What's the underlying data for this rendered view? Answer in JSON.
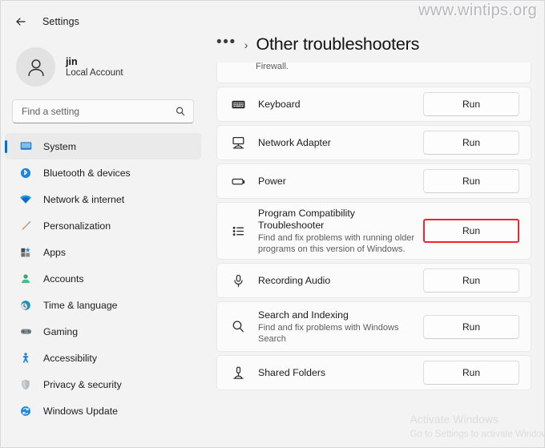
{
  "window": {
    "app_title": "Settings",
    "back_icon": "back-arrow-icon"
  },
  "account": {
    "name": "jin",
    "type": "Local Account",
    "avatar_icon": "user-avatar-icon"
  },
  "search": {
    "placeholder": "Find a setting",
    "value": "",
    "icon": "search-icon"
  },
  "sidebar": {
    "items": [
      {
        "label": "System",
        "icon": "monitor-icon",
        "selected": true
      },
      {
        "label": "Bluetooth & devices",
        "icon": "bluetooth-icon",
        "selected": false
      },
      {
        "label": "Network & internet",
        "icon": "wifi-icon",
        "selected": false
      },
      {
        "label": "Personalization",
        "icon": "paintbrush-icon",
        "selected": false
      },
      {
        "label": "Apps",
        "icon": "apps-icon",
        "selected": false
      },
      {
        "label": "Accounts",
        "icon": "account-person-icon",
        "selected": false
      },
      {
        "label": "Time & language",
        "icon": "clock-globe-icon",
        "selected": false
      },
      {
        "label": "Gaming",
        "icon": "gamepad-icon",
        "selected": false
      },
      {
        "label": "Accessibility",
        "icon": "accessibility-person-icon",
        "selected": false
      },
      {
        "label": "Privacy & security",
        "icon": "shield-icon",
        "selected": false
      },
      {
        "label": "Windows Update",
        "icon": "update-refresh-icon",
        "selected": false
      }
    ]
  },
  "header": {
    "breadcrumb_overflow": "•••",
    "breadcrumb_separator": "›",
    "title": "Other troubleshooters"
  },
  "troubleshooters": [
    {
      "id": "firewall-clipped",
      "title": "",
      "desc": "Firewall.",
      "icon": "",
      "button": "",
      "highlighted": false,
      "clipped": true
    },
    {
      "id": "keyboard",
      "title": "Keyboard",
      "desc": "",
      "icon": "keyboard-icon",
      "button": "Run",
      "highlighted": false,
      "clipped": false
    },
    {
      "id": "network-adapter",
      "title": "Network Adapter",
      "desc": "",
      "icon": "network-adapter-icon",
      "button": "Run",
      "highlighted": false,
      "clipped": false
    },
    {
      "id": "power",
      "title": "Power",
      "desc": "",
      "icon": "battery-icon",
      "button": "Run",
      "highlighted": false,
      "clipped": false
    },
    {
      "id": "program-compatibility",
      "title": "Program Compatibility Troubleshooter",
      "desc": "Find and fix problems with running older programs on this version of Windows.",
      "icon": "bulleted-list-icon",
      "button": "Run",
      "highlighted": true,
      "clipped": false
    },
    {
      "id": "recording-audio",
      "title": "Recording Audio",
      "desc": "",
      "icon": "microphone-icon",
      "button": "Run",
      "highlighted": false,
      "clipped": false
    },
    {
      "id": "search-and-indexing",
      "title": "Search and Indexing",
      "desc": "Find and fix problems with Windows Search",
      "icon": "magnifier-icon",
      "button": "Run",
      "highlighted": false,
      "clipped": false
    },
    {
      "id": "shared-folders",
      "title": "Shared Folders",
      "desc": "",
      "icon": "shared-folders-icon",
      "button": "Run",
      "highlighted": false,
      "clipped": false
    }
  ],
  "watermarks": {
    "site": "www.wintips.org",
    "activate_line1": "Activate Windows",
    "activate_line2": "Go to Settings to activate Windows."
  },
  "colors": {
    "accent": "#0d6cc9",
    "highlight_red": "#f0232e",
    "page_bg": "#f3f3f3",
    "card_bg": "#fbfbfb"
  }
}
